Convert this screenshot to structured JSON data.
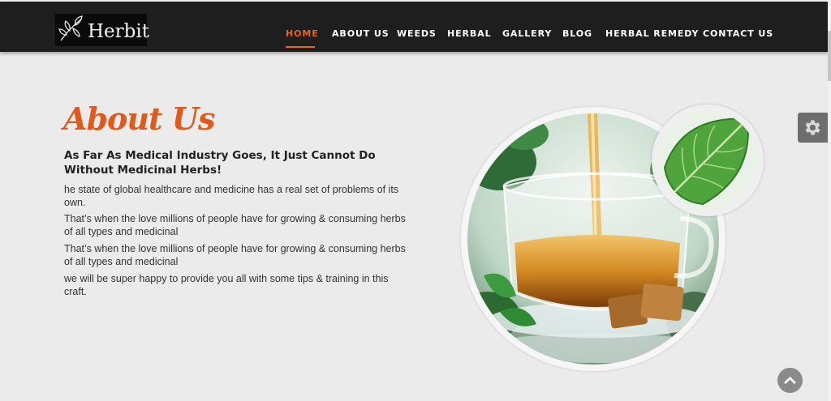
{
  "brand": {
    "name": "Herbit",
    "logo_icon": "leaf-icon"
  },
  "nav": {
    "active": "HOME",
    "items": [
      "HOME",
      "ABOUT US",
      "WEEDS",
      "HERBAL",
      "GALLERY",
      "BLOG",
      "HERBAL REMEDY",
      "CONTACT US"
    ]
  },
  "about": {
    "title": "About Us",
    "subtitle": "As Far As Medical Industry Goes, It Just Cannot Do Without Medicinal Herbs!",
    "paragraphs": [
      "he state of global healthcare and medicine has a real set of problems of its own.",
      "That’s when the love millions of people have for growing & consuming herbs of all types and medicinal",
      "That’s when the love millions of people have for growing & consuming herbs of all types and medicinal",
      "we will be super happy to provide you all with some tips & training in this craft."
    ]
  },
  "images": {
    "main": "herbal-tea-cup-photo",
    "secondary": "green-leaf-photo"
  },
  "widgets": {
    "settings_icon": "gear-icon",
    "scroll_top_icon": "chevron-up-icon"
  },
  "colors": {
    "accent": "#e05a1b",
    "header_bg": "#1e1e1e",
    "page_bg": "#ebebeb"
  }
}
